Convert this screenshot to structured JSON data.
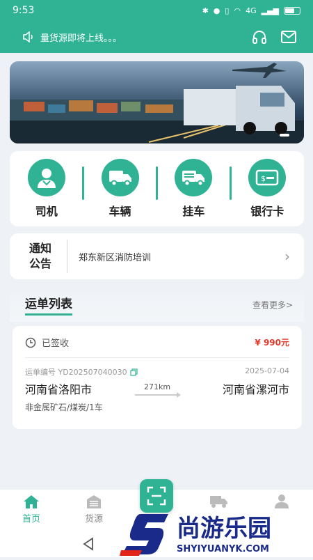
{
  "status_bar": {
    "time": "9:53",
    "network": "4G"
  },
  "header": {
    "notice": "量货源即将上线。。。"
  },
  "quick_menu": [
    {
      "label": "司机",
      "icon": "driver-icon"
    },
    {
      "label": "车辆",
      "icon": "truck-icon"
    },
    {
      "label": "挂车",
      "icon": "trailer-icon"
    },
    {
      "label": "银行卡",
      "icon": "bank-card-icon"
    }
  ],
  "notice_card": {
    "title_line1": "通知",
    "title_line2": "公告",
    "text": "郑东新区消防培训"
  },
  "waybill_section": {
    "title": "运单列表",
    "more": "查看更多>"
  },
  "waybill": {
    "status": "已签收",
    "price": "¥ 990元",
    "number": "运单编号 YD202507040030",
    "date": "2025-07-04",
    "distance": "271km",
    "origin": "河南省洛阳市",
    "destination": "河南省漯河市",
    "goods": "非金属矿石/煤炭/1车"
  },
  "tabbar": [
    {
      "label": "首页",
      "icon": "home-icon",
      "active": true
    },
    {
      "label": "货源",
      "icon": "warehouse-icon",
      "active": false
    },
    {
      "label": "",
      "icon": "scan-icon",
      "active": false
    },
    {
      "label": "",
      "icon": "truck-icon",
      "active": false
    },
    {
      "label": "",
      "icon": "user-icon",
      "active": false
    }
  ],
  "watermark": {
    "brand": "尚游乐园",
    "url": "SHYIYUANYK.COM"
  },
  "colors": {
    "primary": "#2fb394",
    "price": "#e03c2c"
  }
}
